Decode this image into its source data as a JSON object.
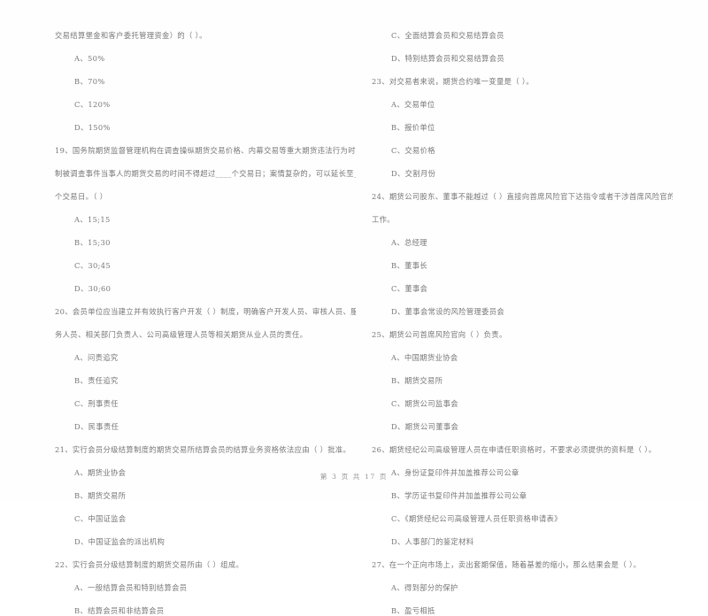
{
  "document": {
    "type": "exam-paper",
    "language": "zh-CN",
    "footer": "第 3 页 共 17 页"
  },
  "left_column": {
    "blocks": [
      {
        "kind": "question-continuation",
        "text": "交易结算堡金和客户委托管理资金）的（      ）。"
      },
      {
        "kind": "option",
        "text": "A、50%"
      },
      {
        "kind": "option",
        "text": "B、70%"
      },
      {
        "kind": "option",
        "text": "C、120%"
      },
      {
        "kind": "option",
        "text": "D、150%"
      },
      {
        "kind": "question",
        "text": "19、国务院期货监督管理机构在调查操纵期货交易价格、内幕交易等重大期货违法行为时，限"
      },
      {
        "kind": "question-line",
        "text": "制被调查事件当事人的期货交易的时间不得超过____个交易日；案情复杂的，可以延长至____"
      },
      {
        "kind": "question-line",
        "text": "个交易日。（    ）"
      },
      {
        "kind": "option",
        "text": "A、15;15"
      },
      {
        "kind": "option",
        "text": "B、15;30"
      },
      {
        "kind": "option",
        "text": "C、30;45"
      },
      {
        "kind": "option",
        "text": "D、30;60"
      },
      {
        "kind": "question",
        "text": "20、会员单位应当建立并有效执行客户开发（      ）制度，明确客户开发人员、审核人员、服"
      },
      {
        "kind": "question-line",
        "text": "务人员、相关部门负责人、公司高级管理人员等相关期货从业人员的责任。"
      },
      {
        "kind": "option",
        "text": "A、问责追究"
      },
      {
        "kind": "option",
        "text": "B、责任追究"
      },
      {
        "kind": "option",
        "text": "C、刑事责任"
      },
      {
        "kind": "option",
        "text": "D、民事责任"
      },
      {
        "kind": "question",
        "text": "21、实行会员分级结算制度的期货交易所结算会员的结算业务资格依法应由（     ）批准。"
      },
      {
        "kind": "option",
        "text": "A、期货业协会"
      },
      {
        "kind": "option",
        "text": "B、期货交易所"
      },
      {
        "kind": "option",
        "text": "C、中国证监会"
      },
      {
        "kind": "option",
        "text": "D、中国证监会的派出机构"
      },
      {
        "kind": "question",
        "text": "22、实行会员分级结算制度的期货交易所由（     ）组成。"
      },
      {
        "kind": "option",
        "text": "A、一般结算会员和特别结算会员"
      },
      {
        "kind": "option",
        "text": "B、结算会员和非结算会员"
      }
    ]
  },
  "right_column": {
    "blocks": [
      {
        "kind": "option",
        "text": "C、全面结算会员和交易结算会员"
      },
      {
        "kind": "option",
        "text": "D、特别结算会员和交易结算会员"
      },
      {
        "kind": "question",
        "text": "23、对交易者来说，期货合约唯一变量是（      ）。"
      },
      {
        "kind": "option",
        "text": "A、交易单位"
      },
      {
        "kind": "option",
        "text": "B、报价单位"
      },
      {
        "kind": "option",
        "text": "C、交易价格"
      },
      {
        "kind": "option",
        "text": "D、交割月份"
      },
      {
        "kind": "question",
        "text": "24、期货公司股东、董事不能越过（      ）直接向首席风险官下达指令或者干涉首席风险官的"
      },
      {
        "kind": "question-line",
        "text": "工作。"
      },
      {
        "kind": "option",
        "text": "A、总经理"
      },
      {
        "kind": "option",
        "text": "B、董事长"
      },
      {
        "kind": "option",
        "text": "C、董事会"
      },
      {
        "kind": "option",
        "text": "D、董事会常设的风险管理委员会"
      },
      {
        "kind": "question",
        "text": "25、期货公司首席风险官向（     ）负责。"
      },
      {
        "kind": "option",
        "text": "A、中国期货业协会"
      },
      {
        "kind": "option",
        "text": "B、期货交易所"
      },
      {
        "kind": "option",
        "text": "C、期货公司监事会"
      },
      {
        "kind": "option",
        "text": "D、期货公司董事会"
      },
      {
        "kind": "question",
        "text": "26、期货经纪公司高级管理人员在申请任职资格时，不要求必须提供的资料是（      ）。"
      },
      {
        "kind": "option",
        "text": "A、身份证复印件并加盖推荐公司公章"
      },
      {
        "kind": "option",
        "text": "B、学历证书复印件并加盖推荐公司公章"
      },
      {
        "kind": "option",
        "text": "C、《期货经纪公司高级管理人员任职资格申请表》"
      },
      {
        "kind": "option",
        "text": "D、人事部门的鉴定材料"
      },
      {
        "kind": "question",
        "text": "27、在一个正向市场上，卖出套期保值，随着基差的缩小，那么结果会是（      ）。"
      },
      {
        "kind": "option",
        "text": "A、得到部分的保护"
      },
      {
        "kind": "option",
        "text": "B、盈亏相抵"
      }
    ]
  }
}
